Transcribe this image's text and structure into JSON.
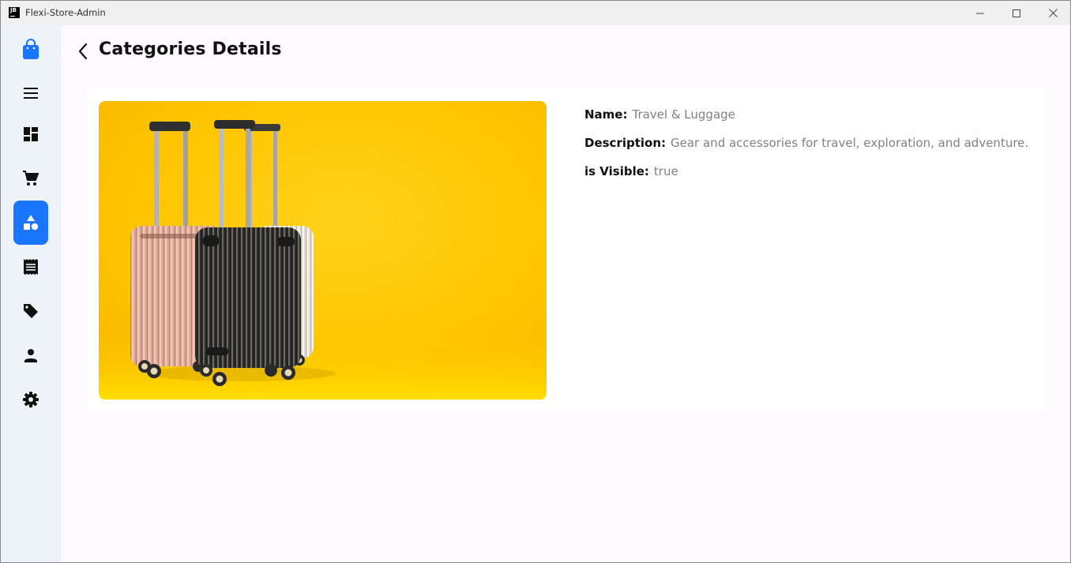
{
  "window": {
    "title": "Flexi-Store-Admin",
    "app_icon_text": "JB"
  },
  "sidebar": {
    "items": [
      {
        "icon": "shopping-bag-icon",
        "active": false
      },
      {
        "icon": "menu-icon",
        "active": false
      },
      {
        "icon": "dashboard-icon",
        "active": false
      },
      {
        "icon": "cart-icon",
        "active": false
      },
      {
        "icon": "category-icon",
        "active": true
      },
      {
        "icon": "receipt-icon",
        "active": false
      },
      {
        "icon": "tag-icon",
        "active": false
      },
      {
        "icon": "person-icon",
        "active": false
      },
      {
        "icon": "settings-icon",
        "active": false
      }
    ],
    "accent_color": "#1a75ff"
  },
  "header": {
    "title": "Categories Details"
  },
  "category": {
    "image": "luggage-photo",
    "name_label": "Name:",
    "name_value": "Travel & Luggage",
    "description_label": "Description:",
    "description_value": "Gear and accessories for travel, exploration, and adventure.",
    "visible_label": "is Visible:",
    "visible_value": "true"
  }
}
